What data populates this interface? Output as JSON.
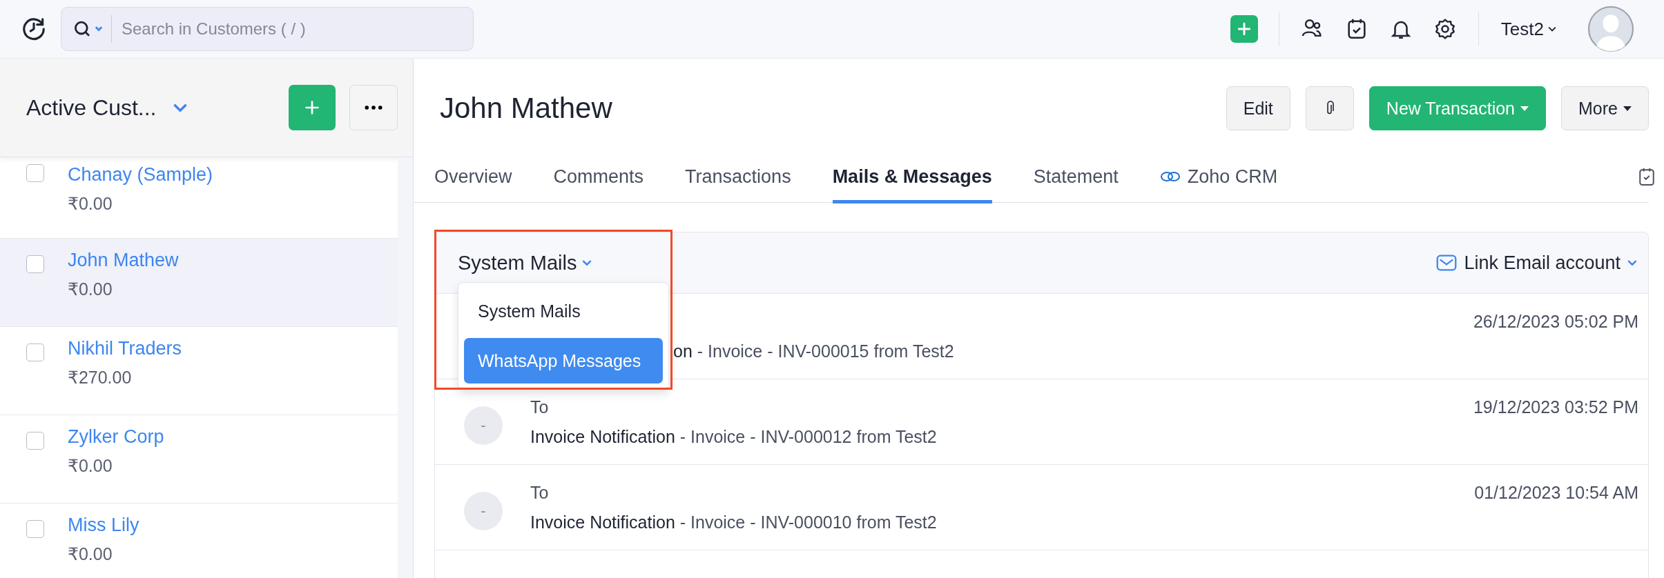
{
  "top_bar": {
    "search": {
      "placeholder": "Search in Customers ( / )"
    },
    "user": "Test2"
  },
  "sidebar": {
    "title": "Active Cust...",
    "items": [
      {
        "name": "Chanay (Sample)",
        "amount": "₹0.00",
        "selected": false,
        "checked": false
      },
      {
        "name": "John Mathew",
        "amount": "₹0.00",
        "selected": true,
        "checked": false
      },
      {
        "name": "Nikhil Traders",
        "amount": "₹270.00",
        "selected": false,
        "checked": false
      },
      {
        "name": "Zylker Corp",
        "amount": "₹0.00",
        "selected": false,
        "checked": false
      },
      {
        "name": "Miss Lily",
        "amount": "₹0.00",
        "selected": false,
        "checked": false
      }
    ]
  },
  "customer": {
    "name": "John Mathew",
    "edit": "Edit",
    "new_transaction": "New Transaction",
    "more": "More"
  },
  "tabs": [
    {
      "label": "Overview",
      "selected": false,
      "kind": "text"
    },
    {
      "label": "Comments",
      "selected": false,
      "kind": "text"
    },
    {
      "label": "Transactions",
      "selected": false,
      "kind": "text"
    },
    {
      "label": "Mails & Messages",
      "selected": true,
      "kind": "text"
    },
    {
      "label": "Statement",
      "selected": false,
      "kind": "text"
    },
    {
      "label": "Zoho CRM",
      "selected": false,
      "kind": "integration"
    }
  ],
  "mails": {
    "filter": "System Mails",
    "link_account": "Link Email account",
    "dropdown": {
      "options": [
        {
          "label": "System Mails",
          "selected": false
        },
        {
          "label": "WhatsApp Messages",
          "selected": true
        }
      ]
    },
    "rows": [
      {
        "kind": "covered",
        "subject": "on",
        "detail": "- Invoice - INV-000015 from Test2",
        "time": "26/12/2023 05:02 PM"
      },
      {
        "kind": "full",
        "avatar": "-",
        "to": "To",
        "subject": "Invoice Notification",
        "detail": "- Invoice - INV-000012 from Test2",
        "time": "19/12/2023 03:52 PM"
      },
      {
        "kind": "full",
        "avatar": "-",
        "to": "To",
        "subject": "Invoice Notification",
        "detail": "- Invoice - INV-000010 from Test2",
        "time": "01/12/2023 10:54 AM"
      }
    ]
  }
}
